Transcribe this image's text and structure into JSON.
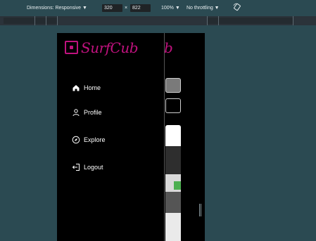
{
  "devtools": {
    "dimensions_label": "Dimensions: Responsive ▼",
    "width_value": "320",
    "times": "×",
    "height_value": "822",
    "zoom_label": "100% ▼",
    "throttling_label": "No throttling ▼",
    "rotate_icon": "rotate-icon"
  },
  "app": {
    "logo_text": "SurfCub",
    "logo_behind_text": "b",
    "brand_color": "#c0127e"
  },
  "nav": {
    "items": [
      {
        "label": "Home",
        "icon": "home-icon"
      },
      {
        "label": "Profile",
        "icon": "user-icon"
      },
      {
        "label": "Explore",
        "icon": "compass-icon"
      },
      {
        "label": "Logout",
        "icon": "logout-icon"
      }
    ]
  }
}
